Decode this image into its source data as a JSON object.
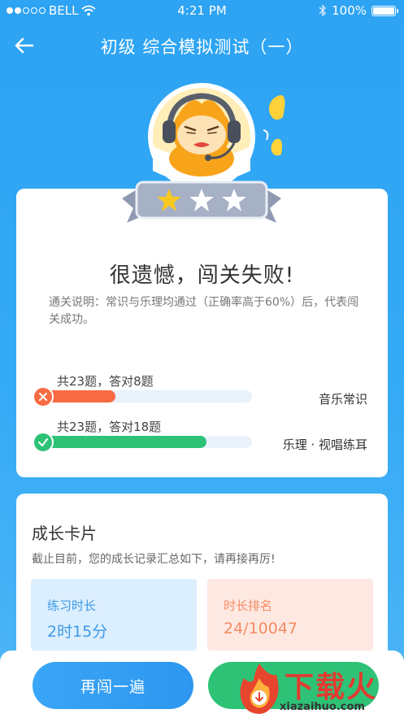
{
  "status_bar": {
    "carrier": "BELL",
    "time": "4:21 PM",
    "battery": "100%"
  },
  "nav": {
    "title": "初级 综合模拟测试（一）"
  },
  "mascot": {
    "stars_earned": 1,
    "stars_total": 3
  },
  "result": {
    "title": "很遗憾，闯关失败!",
    "note": "通关说明：常识与乐理均通过（正确率高于60%）后，代表闯关成功。",
    "scores": [
      {
        "count": "共23题，答对8题",
        "subject": "音乐常识",
        "correct": 8,
        "total": 23,
        "passed": false,
        "color": "#f86b42"
      },
      {
        "count": "共23题，答对18题",
        "subject": "乐理 · 视唱练耳",
        "correct": 18,
        "total": 23,
        "passed": true,
        "color": "#2ec277"
      }
    ]
  },
  "growth": {
    "title": "成长卡片",
    "subtitle": "截止目前，您的成长记录汇总如下，请再接再厉!",
    "practice": {
      "label": "练习时长",
      "value": "2时15分"
    },
    "rank": {
      "label": "时长排名",
      "value": "24/10047"
    }
  },
  "buttons": {
    "retry": "再闯一遍"
  },
  "watermark": {
    "text": "下载火",
    "url": "xiazaihuo.com"
  }
}
